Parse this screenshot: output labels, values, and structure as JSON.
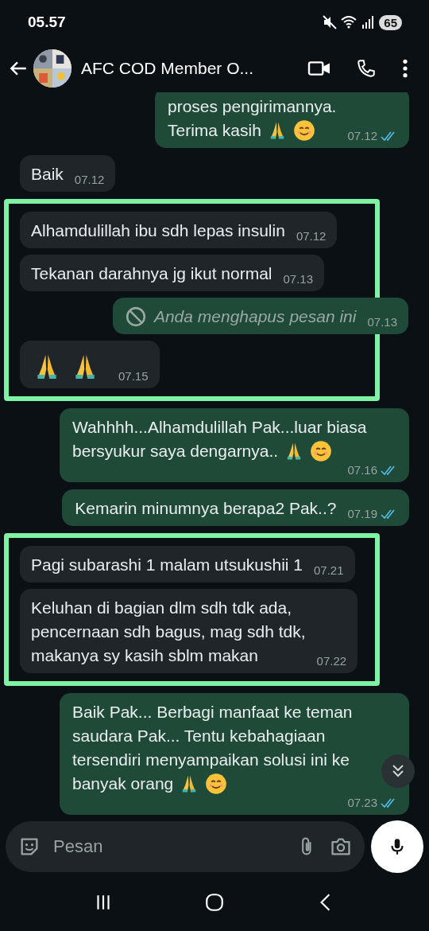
{
  "status_bar": {
    "time": "05.57",
    "battery": "65"
  },
  "header": {
    "title": "AFC COD Member O..."
  },
  "messages": [
    {
      "kind": "text",
      "outgoing": true,
      "lines": [
        "proses pengirimannya.",
        "Terima kasih"
      ],
      "emojis": [
        {
          "kind": "pray"
        },
        {
          "kind": "smile"
        }
      ],
      "time": "07.12",
      "read": true
    },
    {
      "kind": "text",
      "outgoing": false,
      "lines": [
        "Baik"
      ],
      "time": "07.12"
    },
    {
      "kind": "highlight",
      "messages": [
        {
          "kind": "text",
          "outgoing": false,
          "lines": [
            "Alhamdulillah ibu sdh lepas insulin"
          ],
          "time": "07.12"
        },
        {
          "kind": "text",
          "outgoing": false,
          "lines": [
            "Tekanan darahnya jg ikut normal"
          ],
          "time": "07.13"
        },
        {
          "kind": "deleted",
          "outgoing": true,
          "lines": [
            "Anda menghapus pesan ini"
          ],
          "time": "07.13"
        },
        {
          "kind": "emoji",
          "outgoing": false,
          "emojis": [
            {
              "kind": "pray"
            },
            {
              "kind": "pray"
            }
          ],
          "time": "07.15"
        }
      ]
    },
    {
      "kind": "text",
      "outgoing": true,
      "lines": [
        "Wahhhh...Alhamdulillah Pak...luar biasa",
        "bersyukur saya dengarnya.."
      ],
      "emojis": [
        {
          "kind": "pray"
        },
        {
          "kind": "smile"
        }
      ],
      "time": "07.16",
      "read": true
    },
    {
      "kind": "text",
      "outgoing": true,
      "lines": [
        "Kemarin minumnya berapa2 Pak..?"
      ],
      "time": "07.19",
      "read": true
    },
    {
      "kind": "highlight",
      "messages": [
        {
          "kind": "text",
          "outgoing": false,
          "lines": [
            "Pagi subarashi 1 malam utsukushii 1"
          ],
          "time": "07.21"
        },
        {
          "kind": "text",
          "outgoing": false,
          "lines": [
            "Keluhan di bagian dlm sdh tdk ada,",
            "pencernaan sdh bagus, mag sdh tdk,",
            "makanya sy kasih sblm makan"
          ],
          "time": "07.22"
        }
      ]
    },
    {
      "kind": "text",
      "outgoing": true,
      "lines": [
        "Baik Pak... Berbagi manfaat ke teman",
        "saudara Pak... Tentu kebahagiaan",
        "tersendiri menyampaikan solusi ini ke",
        "banyak orang"
      ],
      "emojis": [
        {
          "kind": "pray"
        },
        {
          "kind": "smile"
        }
      ],
      "time": "07.23",
      "read": true
    }
  ],
  "composer": {
    "placeholder": "Pesan"
  }
}
